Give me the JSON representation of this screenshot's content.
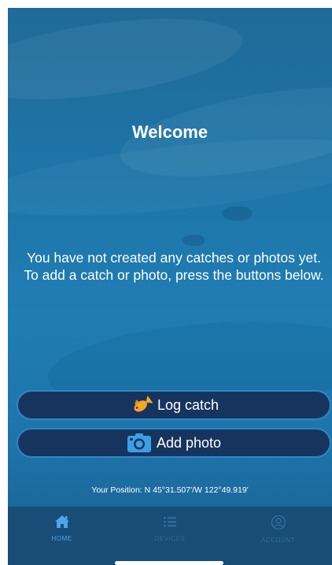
{
  "screen": {
    "title": "Welcome",
    "message": "You have not created any catches or photos yet. To add a catch or photo, press the buttons below."
  },
  "actions": {
    "log_catch": {
      "label": "Log catch",
      "icon": "fish-icon",
      "icon_color": "#f5a623"
    },
    "add_photo": {
      "label": "Add photo",
      "icon": "camera-icon",
      "icon_color": "#3aa0e6"
    }
  },
  "position": {
    "text": "Your Position: N 45°31.507'/W 122°49.919'"
  },
  "tabbar": {
    "items": [
      {
        "label": "HOME",
        "icon": "home-icon",
        "active": true
      },
      {
        "label": "DEVICES",
        "icon": "list-icon",
        "active": false
      },
      {
        "label": "ACCOUNT",
        "icon": "account-icon",
        "active": false
      }
    ]
  },
  "colors": {
    "background": "#1e74a7",
    "button_fill": "#17345f",
    "button_border": "#2f86c4",
    "tabbar": "#174d77",
    "active_tab": "#4da6e8",
    "inactive_tab": "#2f6c9a"
  }
}
